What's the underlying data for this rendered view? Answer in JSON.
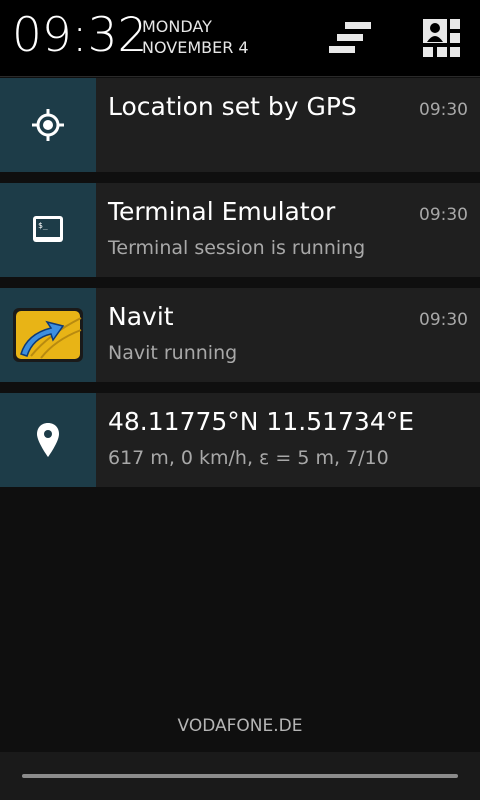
{
  "header": {
    "time": "09:32",
    "day": "MONDAY",
    "date": "NOVEMBER 4",
    "clear_icon": "clear-all-icon",
    "settings_icon": "quick-settings-icon"
  },
  "notifications": [
    {
      "icon": "gps-target-icon",
      "title": "Location set by GPS",
      "subtitle": "",
      "time": "09:30"
    },
    {
      "icon": "terminal-icon",
      "title": "Terminal Emulator",
      "subtitle": "Terminal session is running",
      "time": "09:30"
    },
    {
      "icon": "navit-app-icon",
      "title": "Navit",
      "subtitle": "Navit running",
      "time": "09:30"
    },
    {
      "icon": "map-pin-icon",
      "title": "48.11775°N 11.51734°E",
      "subtitle": "617 m, 0 km/h, ε = 5 m, 7/10",
      "time": ""
    }
  ],
  "carrier": "VODAFONE.DE",
  "colors": {
    "icon_bg": "#1d3c48",
    "card_bg": "#1f1f1f",
    "panel_bg": "#0f0f0f"
  }
}
